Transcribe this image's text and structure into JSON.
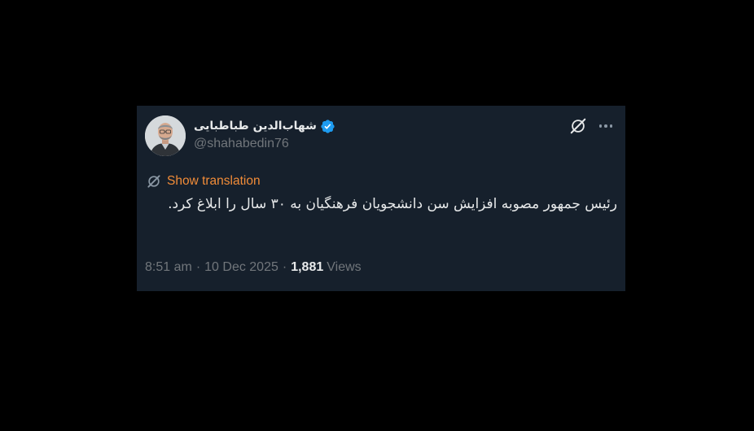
{
  "tweet": {
    "author": {
      "display_name": "شهاب‌الدین طباطبایی",
      "handle": "@shahabedin76",
      "verified": true,
      "avatar_icon": "person-avatar"
    },
    "translate_label": "Show translation",
    "text": "رئیس جمهور مصوبه افزایش سن دانشجویان فرهنگیان به ۳۰ سال را ابلاغ کرد.",
    "time": "8:51 am",
    "date": "10 Dec 2025",
    "separator": "·",
    "views_count": "1,881",
    "views_label": "Views"
  },
  "colors": {
    "background": "#000000",
    "card": "#16202c",
    "primary_text": "#e7e9ea",
    "secondary_text": "#71767b",
    "verified": "#1d9bf0",
    "translate_accent": "#f28c38"
  },
  "icons": [
    "verified-badge-icon",
    "grok-icon",
    "more-options-icon",
    "translate-grok-icon"
  ]
}
